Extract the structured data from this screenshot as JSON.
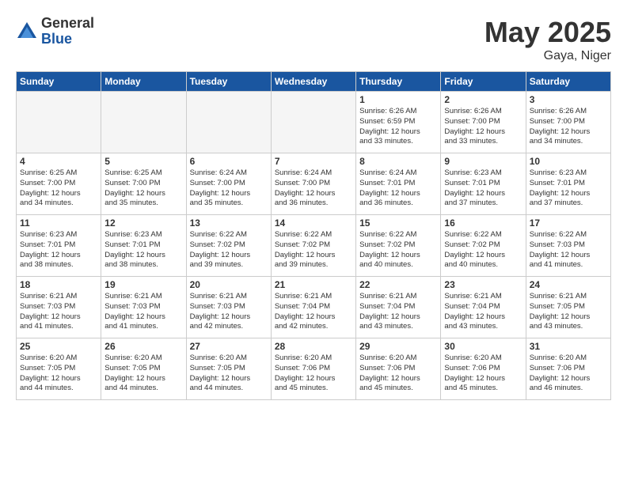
{
  "logo": {
    "general": "General",
    "blue": "Blue"
  },
  "header": {
    "month": "May 2025",
    "location": "Gaya, Niger"
  },
  "weekdays": [
    "Sunday",
    "Monday",
    "Tuesday",
    "Wednesday",
    "Thursday",
    "Friday",
    "Saturday"
  ],
  "weeks": [
    [
      {
        "day": "",
        "info": ""
      },
      {
        "day": "",
        "info": ""
      },
      {
        "day": "",
        "info": ""
      },
      {
        "day": "",
        "info": ""
      },
      {
        "day": "1",
        "info": "Sunrise: 6:26 AM\nSunset: 6:59 PM\nDaylight: 12 hours\nand 33 minutes."
      },
      {
        "day": "2",
        "info": "Sunrise: 6:26 AM\nSunset: 7:00 PM\nDaylight: 12 hours\nand 33 minutes."
      },
      {
        "day": "3",
        "info": "Sunrise: 6:26 AM\nSunset: 7:00 PM\nDaylight: 12 hours\nand 34 minutes."
      }
    ],
    [
      {
        "day": "4",
        "info": "Sunrise: 6:25 AM\nSunset: 7:00 PM\nDaylight: 12 hours\nand 34 minutes."
      },
      {
        "day": "5",
        "info": "Sunrise: 6:25 AM\nSunset: 7:00 PM\nDaylight: 12 hours\nand 35 minutes."
      },
      {
        "day": "6",
        "info": "Sunrise: 6:24 AM\nSunset: 7:00 PM\nDaylight: 12 hours\nand 35 minutes."
      },
      {
        "day": "7",
        "info": "Sunrise: 6:24 AM\nSunset: 7:00 PM\nDaylight: 12 hours\nand 36 minutes."
      },
      {
        "day": "8",
        "info": "Sunrise: 6:24 AM\nSunset: 7:01 PM\nDaylight: 12 hours\nand 36 minutes."
      },
      {
        "day": "9",
        "info": "Sunrise: 6:23 AM\nSunset: 7:01 PM\nDaylight: 12 hours\nand 37 minutes."
      },
      {
        "day": "10",
        "info": "Sunrise: 6:23 AM\nSunset: 7:01 PM\nDaylight: 12 hours\nand 37 minutes."
      }
    ],
    [
      {
        "day": "11",
        "info": "Sunrise: 6:23 AM\nSunset: 7:01 PM\nDaylight: 12 hours\nand 38 minutes."
      },
      {
        "day": "12",
        "info": "Sunrise: 6:23 AM\nSunset: 7:01 PM\nDaylight: 12 hours\nand 38 minutes."
      },
      {
        "day": "13",
        "info": "Sunrise: 6:22 AM\nSunset: 7:02 PM\nDaylight: 12 hours\nand 39 minutes."
      },
      {
        "day": "14",
        "info": "Sunrise: 6:22 AM\nSunset: 7:02 PM\nDaylight: 12 hours\nand 39 minutes."
      },
      {
        "day": "15",
        "info": "Sunrise: 6:22 AM\nSunset: 7:02 PM\nDaylight: 12 hours\nand 40 minutes."
      },
      {
        "day": "16",
        "info": "Sunrise: 6:22 AM\nSunset: 7:02 PM\nDaylight: 12 hours\nand 40 minutes."
      },
      {
        "day": "17",
        "info": "Sunrise: 6:22 AM\nSunset: 7:03 PM\nDaylight: 12 hours\nand 41 minutes."
      }
    ],
    [
      {
        "day": "18",
        "info": "Sunrise: 6:21 AM\nSunset: 7:03 PM\nDaylight: 12 hours\nand 41 minutes."
      },
      {
        "day": "19",
        "info": "Sunrise: 6:21 AM\nSunset: 7:03 PM\nDaylight: 12 hours\nand 41 minutes."
      },
      {
        "day": "20",
        "info": "Sunrise: 6:21 AM\nSunset: 7:03 PM\nDaylight: 12 hours\nand 42 minutes."
      },
      {
        "day": "21",
        "info": "Sunrise: 6:21 AM\nSunset: 7:04 PM\nDaylight: 12 hours\nand 42 minutes."
      },
      {
        "day": "22",
        "info": "Sunrise: 6:21 AM\nSunset: 7:04 PM\nDaylight: 12 hours\nand 43 minutes."
      },
      {
        "day": "23",
        "info": "Sunrise: 6:21 AM\nSunset: 7:04 PM\nDaylight: 12 hours\nand 43 minutes."
      },
      {
        "day": "24",
        "info": "Sunrise: 6:21 AM\nSunset: 7:05 PM\nDaylight: 12 hours\nand 43 minutes."
      }
    ],
    [
      {
        "day": "25",
        "info": "Sunrise: 6:20 AM\nSunset: 7:05 PM\nDaylight: 12 hours\nand 44 minutes."
      },
      {
        "day": "26",
        "info": "Sunrise: 6:20 AM\nSunset: 7:05 PM\nDaylight: 12 hours\nand 44 minutes."
      },
      {
        "day": "27",
        "info": "Sunrise: 6:20 AM\nSunset: 7:05 PM\nDaylight: 12 hours\nand 44 minutes."
      },
      {
        "day": "28",
        "info": "Sunrise: 6:20 AM\nSunset: 7:06 PM\nDaylight: 12 hours\nand 45 minutes."
      },
      {
        "day": "29",
        "info": "Sunrise: 6:20 AM\nSunset: 7:06 PM\nDaylight: 12 hours\nand 45 minutes."
      },
      {
        "day": "30",
        "info": "Sunrise: 6:20 AM\nSunset: 7:06 PM\nDaylight: 12 hours\nand 45 minutes."
      },
      {
        "day": "31",
        "info": "Sunrise: 6:20 AM\nSunset: 7:06 PM\nDaylight: 12 hours\nand 46 minutes."
      }
    ]
  ]
}
